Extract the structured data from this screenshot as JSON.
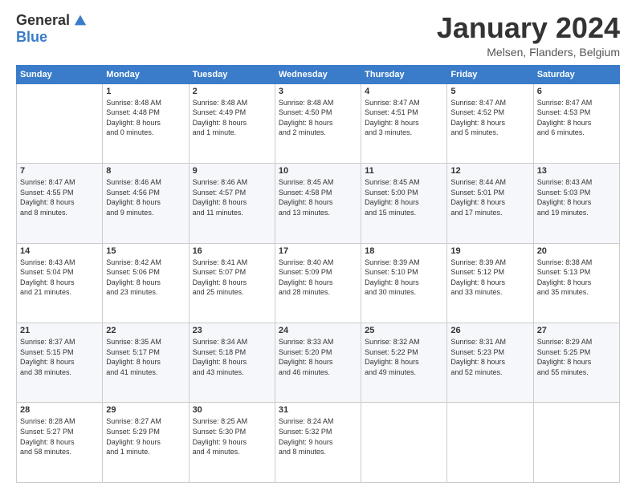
{
  "logo": {
    "general": "General",
    "blue": "Blue"
  },
  "title": "January 2024",
  "subtitle": "Melsen, Flanders, Belgium",
  "days_header": [
    "Sunday",
    "Monday",
    "Tuesday",
    "Wednesday",
    "Thursday",
    "Friday",
    "Saturday"
  ],
  "weeks": [
    [
      {
        "day": "",
        "info": ""
      },
      {
        "day": "1",
        "info": "Sunrise: 8:48 AM\nSunset: 4:48 PM\nDaylight: 8 hours\nand 0 minutes."
      },
      {
        "day": "2",
        "info": "Sunrise: 8:48 AM\nSunset: 4:49 PM\nDaylight: 8 hours\nand 1 minute."
      },
      {
        "day": "3",
        "info": "Sunrise: 8:48 AM\nSunset: 4:50 PM\nDaylight: 8 hours\nand 2 minutes."
      },
      {
        "day": "4",
        "info": "Sunrise: 8:47 AM\nSunset: 4:51 PM\nDaylight: 8 hours\nand 3 minutes."
      },
      {
        "day": "5",
        "info": "Sunrise: 8:47 AM\nSunset: 4:52 PM\nDaylight: 8 hours\nand 5 minutes."
      },
      {
        "day": "6",
        "info": "Sunrise: 8:47 AM\nSunset: 4:53 PM\nDaylight: 8 hours\nand 6 minutes."
      }
    ],
    [
      {
        "day": "7",
        "info": "Sunrise: 8:47 AM\nSunset: 4:55 PM\nDaylight: 8 hours\nand 8 minutes."
      },
      {
        "day": "8",
        "info": "Sunrise: 8:46 AM\nSunset: 4:56 PM\nDaylight: 8 hours\nand 9 minutes."
      },
      {
        "day": "9",
        "info": "Sunrise: 8:46 AM\nSunset: 4:57 PM\nDaylight: 8 hours\nand 11 minutes."
      },
      {
        "day": "10",
        "info": "Sunrise: 8:45 AM\nSunset: 4:58 PM\nDaylight: 8 hours\nand 13 minutes."
      },
      {
        "day": "11",
        "info": "Sunrise: 8:45 AM\nSunset: 5:00 PM\nDaylight: 8 hours\nand 15 minutes."
      },
      {
        "day": "12",
        "info": "Sunrise: 8:44 AM\nSunset: 5:01 PM\nDaylight: 8 hours\nand 17 minutes."
      },
      {
        "day": "13",
        "info": "Sunrise: 8:43 AM\nSunset: 5:03 PM\nDaylight: 8 hours\nand 19 minutes."
      }
    ],
    [
      {
        "day": "14",
        "info": "Sunrise: 8:43 AM\nSunset: 5:04 PM\nDaylight: 8 hours\nand 21 minutes."
      },
      {
        "day": "15",
        "info": "Sunrise: 8:42 AM\nSunset: 5:06 PM\nDaylight: 8 hours\nand 23 minutes."
      },
      {
        "day": "16",
        "info": "Sunrise: 8:41 AM\nSunset: 5:07 PM\nDaylight: 8 hours\nand 25 minutes."
      },
      {
        "day": "17",
        "info": "Sunrise: 8:40 AM\nSunset: 5:09 PM\nDaylight: 8 hours\nand 28 minutes."
      },
      {
        "day": "18",
        "info": "Sunrise: 8:39 AM\nSunset: 5:10 PM\nDaylight: 8 hours\nand 30 minutes."
      },
      {
        "day": "19",
        "info": "Sunrise: 8:39 AM\nSunset: 5:12 PM\nDaylight: 8 hours\nand 33 minutes."
      },
      {
        "day": "20",
        "info": "Sunrise: 8:38 AM\nSunset: 5:13 PM\nDaylight: 8 hours\nand 35 minutes."
      }
    ],
    [
      {
        "day": "21",
        "info": "Sunrise: 8:37 AM\nSunset: 5:15 PM\nDaylight: 8 hours\nand 38 minutes."
      },
      {
        "day": "22",
        "info": "Sunrise: 8:35 AM\nSunset: 5:17 PM\nDaylight: 8 hours\nand 41 minutes."
      },
      {
        "day": "23",
        "info": "Sunrise: 8:34 AM\nSunset: 5:18 PM\nDaylight: 8 hours\nand 43 minutes."
      },
      {
        "day": "24",
        "info": "Sunrise: 8:33 AM\nSunset: 5:20 PM\nDaylight: 8 hours\nand 46 minutes."
      },
      {
        "day": "25",
        "info": "Sunrise: 8:32 AM\nSunset: 5:22 PM\nDaylight: 8 hours\nand 49 minutes."
      },
      {
        "day": "26",
        "info": "Sunrise: 8:31 AM\nSunset: 5:23 PM\nDaylight: 8 hours\nand 52 minutes."
      },
      {
        "day": "27",
        "info": "Sunrise: 8:29 AM\nSunset: 5:25 PM\nDaylight: 8 hours\nand 55 minutes."
      }
    ],
    [
      {
        "day": "28",
        "info": "Sunrise: 8:28 AM\nSunset: 5:27 PM\nDaylight: 8 hours\nand 58 minutes."
      },
      {
        "day": "29",
        "info": "Sunrise: 8:27 AM\nSunset: 5:29 PM\nDaylight: 9 hours\nand 1 minute."
      },
      {
        "day": "30",
        "info": "Sunrise: 8:25 AM\nSunset: 5:30 PM\nDaylight: 9 hours\nand 4 minutes."
      },
      {
        "day": "31",
        "info": "Sunrise: 8:24 AM\nSunset: 5:32 PM\nDaylight: 9 hours\nand 8 minutes."
      },
      {
        "day": "",
        "info": ""
      },
      {
        "day": "",
        "info": ""
      },
      {
        "day": "",
        "info": ""
      }
    ]
  ]
}
